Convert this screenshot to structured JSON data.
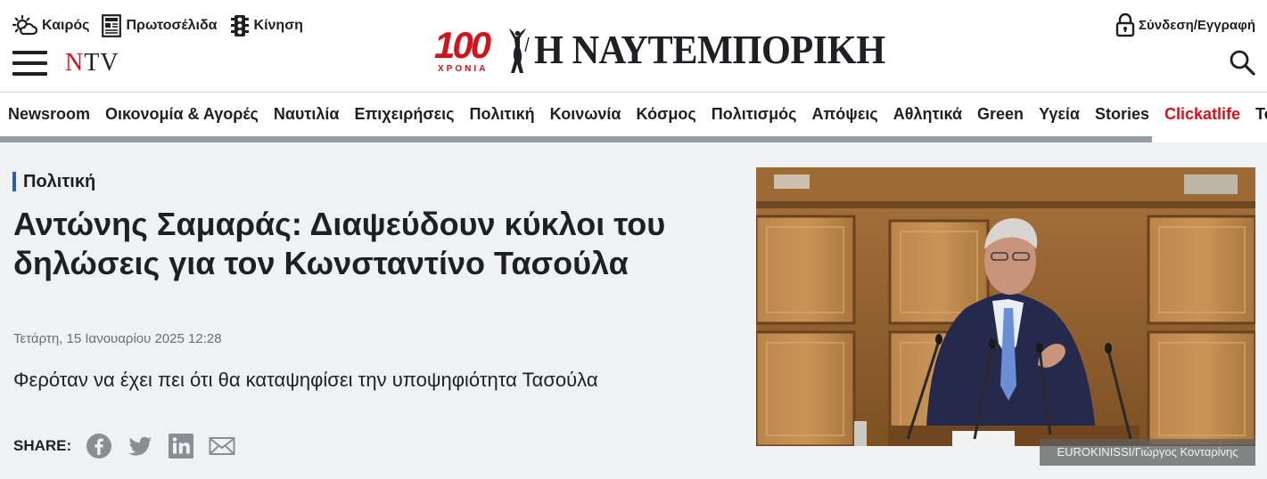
{
  "header": {
    "toplinks": [
      {
        "icon": "weather-icon",
        "label": "Καιρός"
      },
      {
        "icon": "newspaper-icon",
        "label": "Πρωτοσέλιδα"
      },
      {
        "icon": "traffic-light-icon",
        "label": "Κίνηση"
      }
    ],
    "ntv": {
      "n": "N",
      "tv": "TV"
    },
    "logo": {
      "number": "100",
      "years": "ΧΡΟΝΙΑ",
      "title": "Η ΝΑΥΤΕΜΠΟΡΙΚΗ"
    },
    "login_label": "Σύνδεση/Εγγραφή"
  },
  "nav": {
    "items": [
      "Newsroom",
      "Οικονομία & Αγορές",
      "Ναυτιλία",
      "Επιχειρήσεις",
      "Πολιτική",
      "Κοινωνία",
      "Κόσμος",
      "Πολιτισμός",
      "Απόψεις",
      "Αθλητικά",
      "Green",
      "Υγεία",
      "Stories",
      "Clickatlife",
      "Te"
    ],
    "highlight": "Clickatlife"
  },
  "article": {
    "category": "Πολιτική",
    "headline": "Αντώνης Σαμαράς: Διαψεύδουν κύκλοι του δηλώσεις για τον Κωνσταντίνο Τασούλα",
    "date": "Τετάρτη, 15 Ιανουαρίου 2025 12:28",
    "lead": "Φερόταν να έχει πει ότι θα καταψηφίσει την υποψηφιότητα Τασούλα",
    "share_label": "SHARE:",
    "share_icons": [
      "facebook-icon",
      "twitter-icon",
      "linkedin-icon",
      "email-icon"
    ],
    "photo_caption": "EUROKINISSI/Γιώργος Κονταρίνης"
  },
  "colors": {
    "accent_red": "#d4121b",
    "category_bar": "#2f5f9e",
    "article_bg": "#f0f1f3"
  }
}
